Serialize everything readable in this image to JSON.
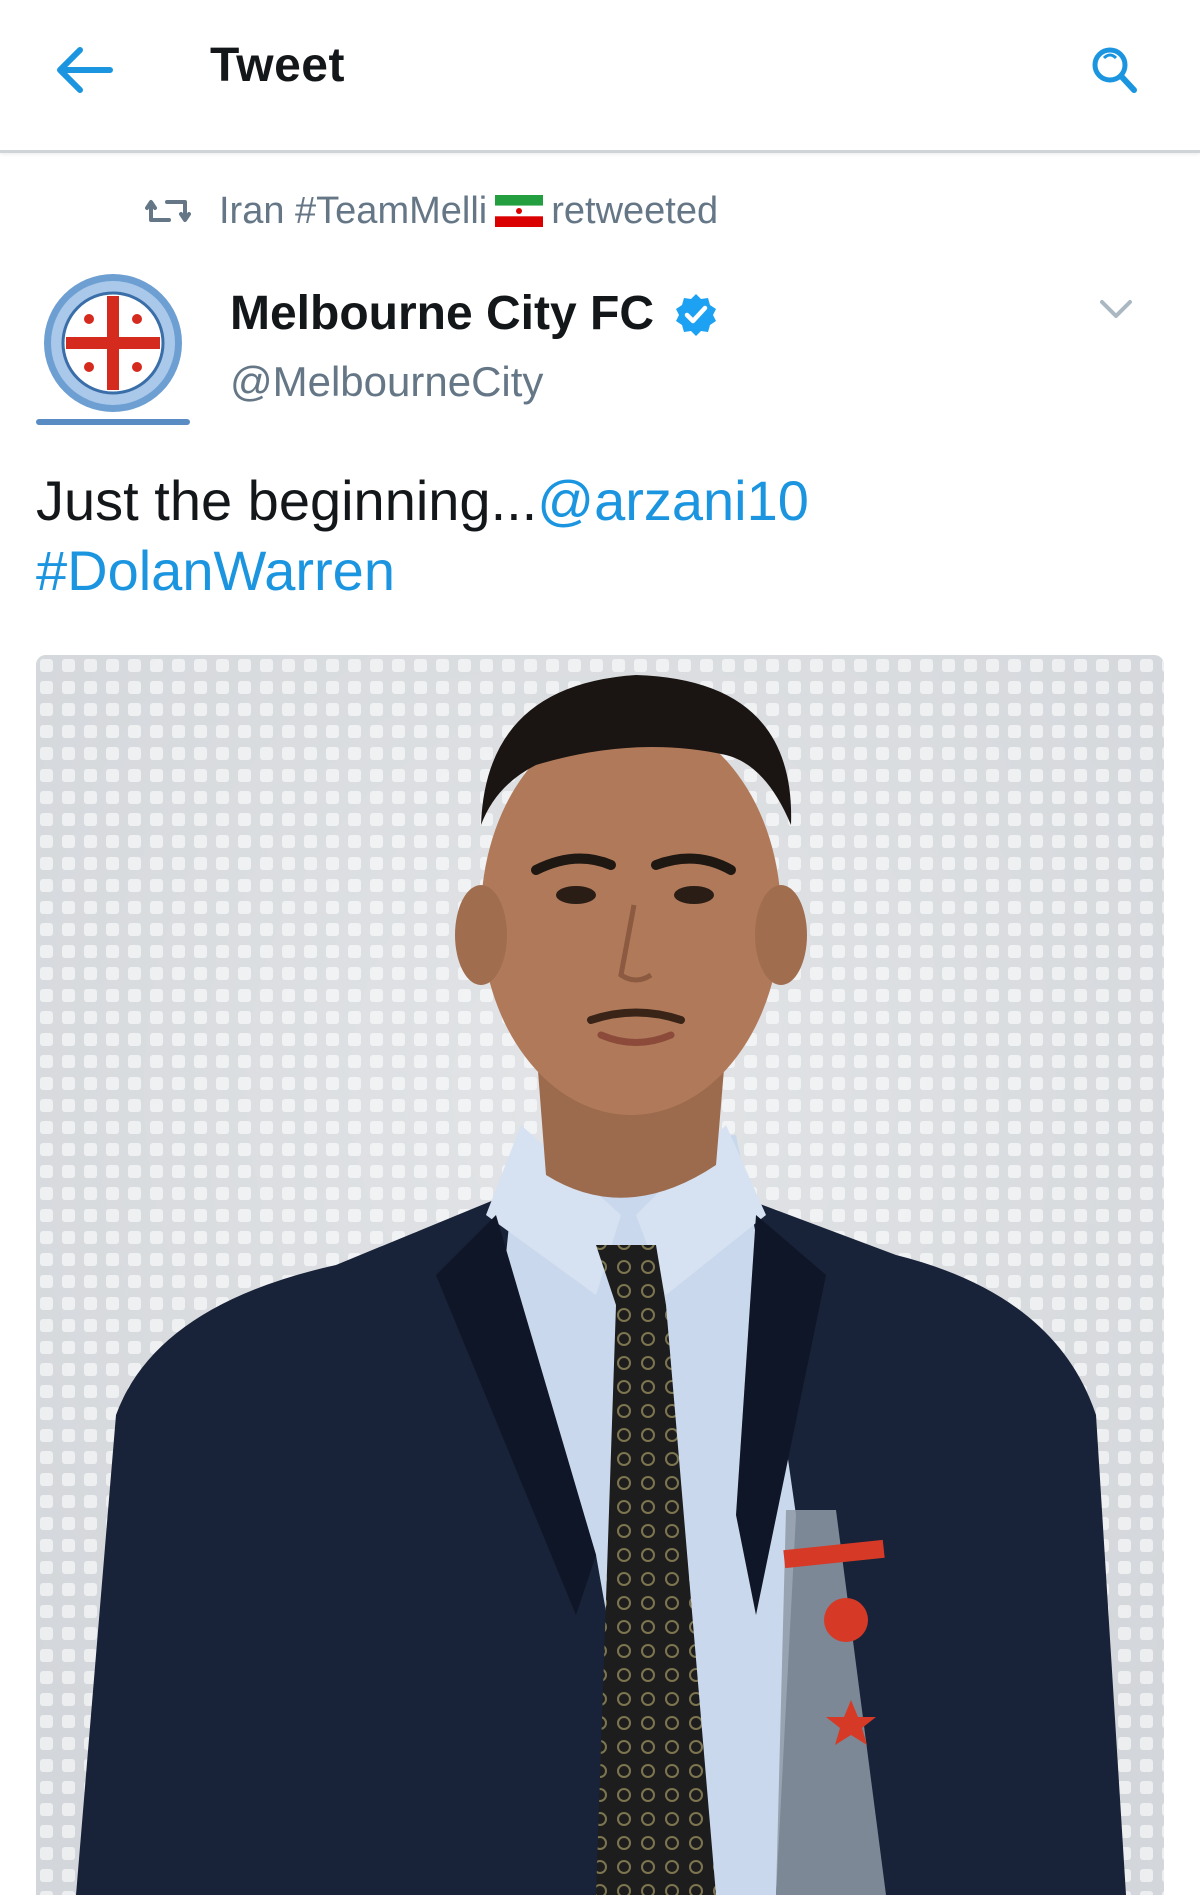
{
  "header": {
    "title": "Tweet",
    "back_icon": "arrow-left-icon",
    "search_icon": "search-icon",
    "accent_color": "#1b95e0"
  },
  "retweet": {
    "icon": "retweet-icon",
    "account": "Iran #TeamMelli",
    "flag_icon": "iran-flag-icon",
    "suffix": "retweeted"
  },
  "tweet": {
    "author_name": "Melbourne City FC",
    "author_handle": "@MelbourneCity",
    "verified": true,
    "text_plain": "Just the beginning...",
    "mention": "@arzani10",
    "hashtag": "#DolanWarren",
    "media_type": "photo"
  },
  "colors": {
    "text_primary": "#14171a",
    "text_secondary": "#657786",
    "link": "#1b95e0",
    "divider": "#cfd4d8"
  }
}
